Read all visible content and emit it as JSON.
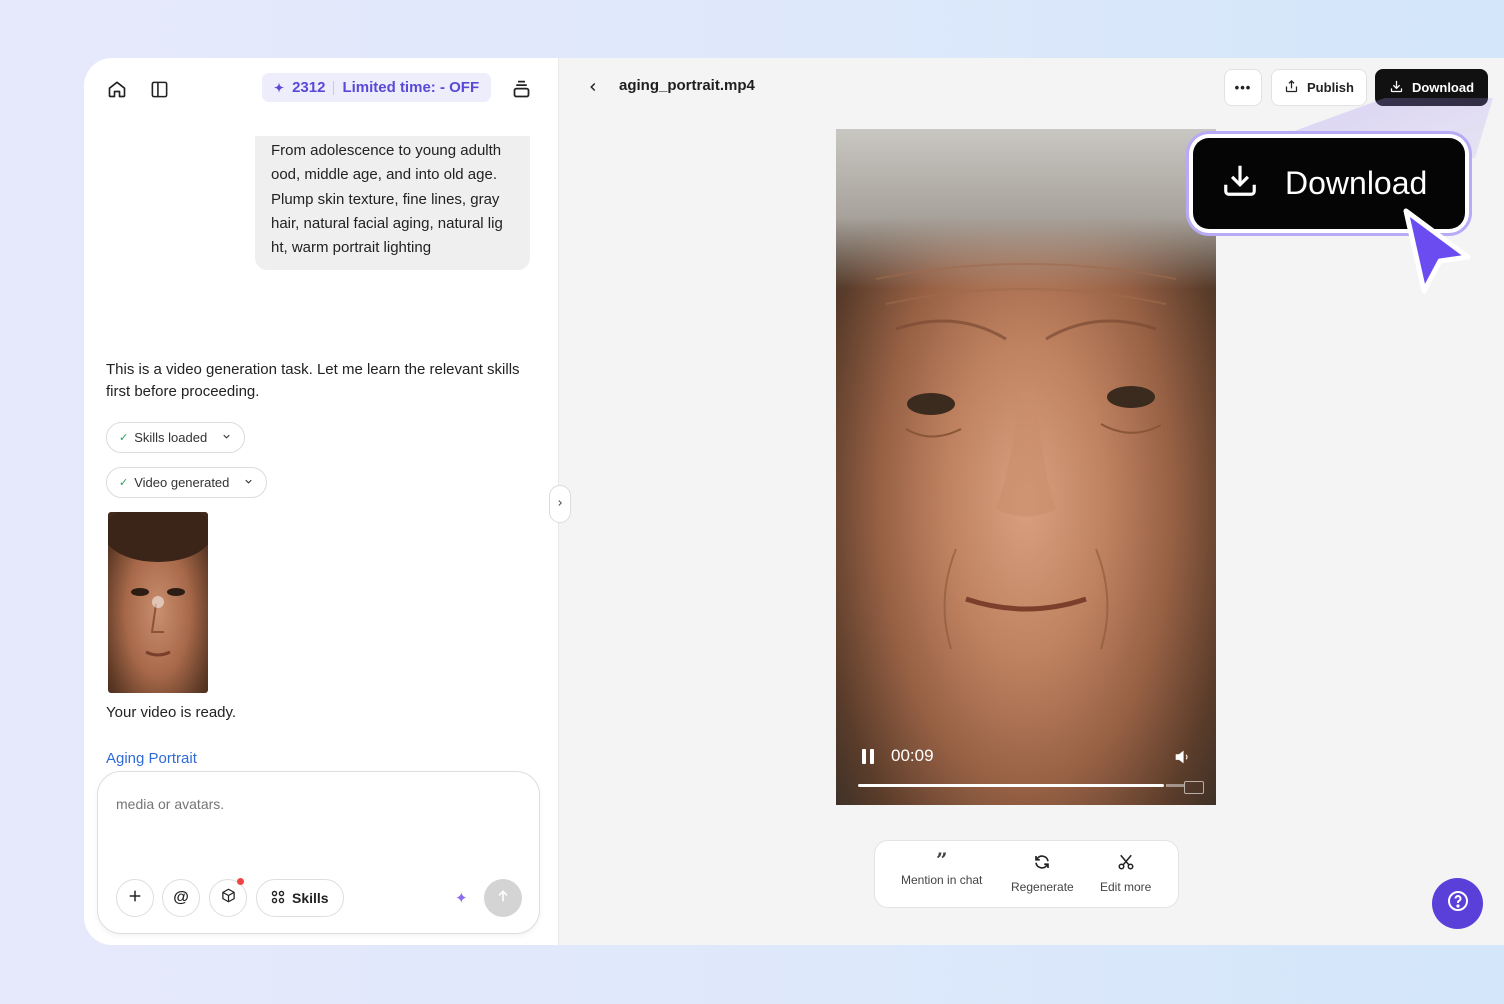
{
  "header": {
    "credits": "2312",
    "promo": "Limited time: - OFF"
  },
  "chat": {
    "user_prompt": "From adolescence to young adulth ood, middle age, and into old age. Plump skin texture, fine lines, gray hair, natural facial aging, natural lig ht, warm portrait lighting",
    "assistant_intro": "This is a video generation task. Let me learn the relevant skills first before proceeding.",
    "chips": [
      {
        "label": "Skills loaded"
      },
      {
        "label": "Video generated"
      }
    ],
    "ready_text": "Your video is ready.",
    "link_text": "Aging Portrait"
  },
  "composer": {
    "placeholder": "media or avatars.",
    "skills_label": "Skills"
  },
  "viewer": {
    "filename": "aging_portrait.mp4",
    "publish_label": "Publish",
    "download_label": "Download",
    "time": "00:09",
    "progress": 0.94
  },
  "actions": [
    {
      "label": "Mention in chat",
      "icon": "quote-icon"
    },
    {
      "label": "Regenerate",
      "icon": "refresh-icon"
    },
    {
      "label": "Edit more",
      "icon": "scissors-icon"
    }
  ],
  "callout": {
    "label": "Download"
  },
  "colors": {
    "accent": "#5a49d6",
    "help": "#5b3fd9",
    "download_bg": "#111111",
    "link": "#2f6bd9"
  }
}
